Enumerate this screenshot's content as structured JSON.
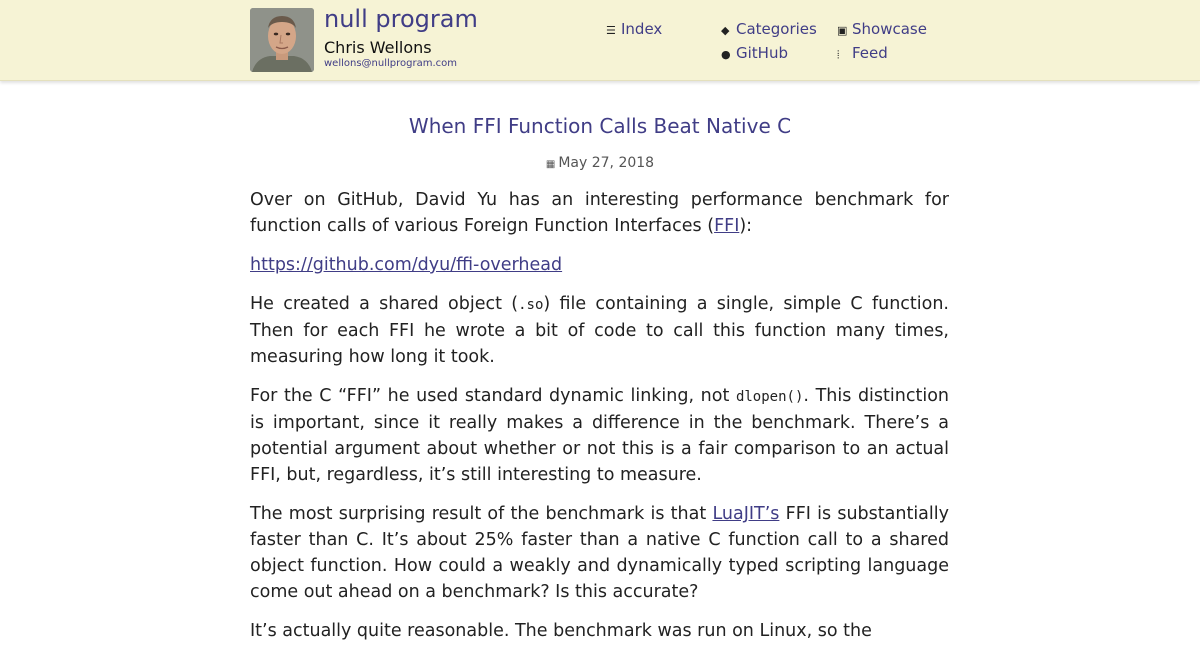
{
  "header": {
    "site_title": "null program",
    "author": "Chris Wellons",
    "email": "wellons@nullprogram.com",
    "nav": [
      {
        "label": "Index",
        "icon": "list-icon"
      },
      {
        "label": "Categories",
        "icon": "tag-icon"
      },
      {
        "label": "Showcase",
        "icon": "badge-icon"
      },
      {
        "label": "GitHub",
        "icon": "github-icon"
      },
      {
        "label": "Feed",
        "icon": "rss-icon"
      }
    ]
  },
  "post": {
    "title": "When FFI Function Calls Beat Native C",
    "date": "May 27, 2018",
    "p1_a": "Over on GitHub, David Yu has an interesting performance benchmark for function calls of various Foreign Function Interfaces (",
    "p1_link": "FFI",
    "p1_b": "):",
    "repo_link": "https://github.com/dyu/ffi-overhead",
    "p3_a": "He created a shared object (",
    "p3_code": ".so",
    "p3_b": ") file containing a single, simple C function. Then for each FFI he wrote a bit of code to call this function many times, measuring how long it took.",
    "p4_a": "For the C “FFI” he used standard dynamic linking, not ",
    "p4_code": "dlopen()",
    "p4_b": ". This distinction is important, since it really makes a difference in the benchmark. There’s a potential argument about whether or not this is a fair comparison to an actual FFI, but, regardless, it’s still interesting to measure.",
    "p5_a": "The most surprising result of the benchmark is that ",
    "p5_link": "LuaJIT’s",
    "p5_b": " FFI is substantially faster than C. It’s about 25% faster than a native C function call to a shared object function. How could a weakly and dynamically typed scripting language come out ahead on a benchmark? Is this accurate?",
    "p6": "It’s actually quite reasonable. The benchmark was run on Linux, so the"
  }
}
